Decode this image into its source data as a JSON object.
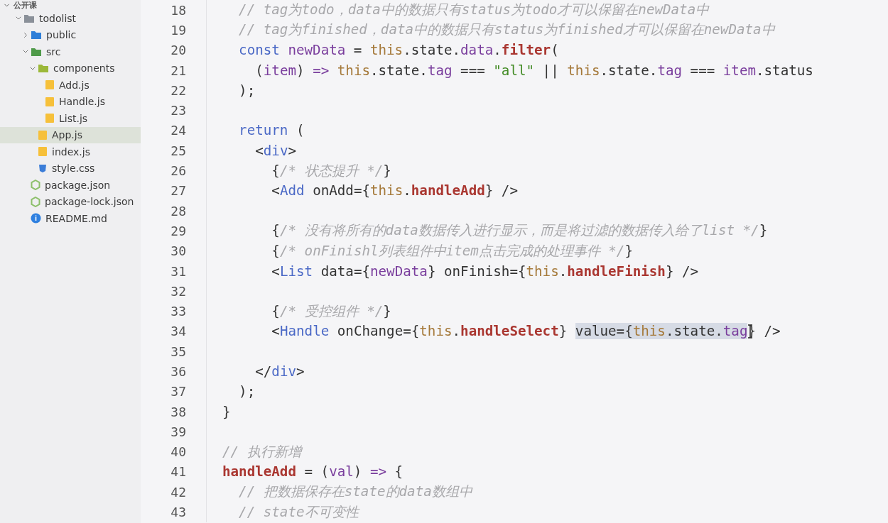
{
  "explorer": {
    "root": {
      "name": "公开课",
      "expanded": true
    },
    "items": [
      {
        "name": "todolist",
        "kind": "folder",
        "color": "#8a9099",
        "expanded": true,
        "selected": false,
        "children": [
          {
            "name": "public",
            "kind": "folder",
            "color": "#2f7fd8",
            "expanded": false,
            "selected": false
          },
          {
            "name": "src",
            "kind": "folder",
            "color": "#4f9a4a",
            "expanded": true,
            "selected": false,
            "children": [
              {
                "name": "components",
                "kind": "folder",
                "color": "#9cb83a",
                "expanded": true,
                "selected": false,
                "children": [
                  {
                    "name": "Add.js",
                    "kind": "js",
                    "selected": false
                  },
                  {
                    "name": "Handle.js",
                    "kind": "js",
                    "selected": false
                  },
                  {
                    "name": "List.js",
                    "kind": "js",
                    "selected": false
                  }
                ]
              },
              {
                "name": "App.js",
                "kind": "js",
                "selected": true
              },
              {
                "name": "index.js",
                "kind": "js",
                "selected": false
              },
              {
                "name": "style.css",
                "kind": "css",
                "selected": false
              }
            ]
          },
          {
            "name": "package.json",
            "kind": "json",
            "selected": false
          },
          {
            "name": "package-lock.json",
            "kind": "json",
            "selected": false
          },
          {
            "name": "README.md",
            "kind": "info",
            "selected": false
          }
        ]
      }
    ]
  },
  "editor": {
    "lines": [
      {
        "number": "18",
        "kind": "inner",
        "segments": [
          {
            "selected": false,
            "tokens": [
              {
                "text": "// tag为todo，data中的数据只有status为todo才可以保留在newData中",
                "kind": "comment"
              }
            ]
          }
        ]
      },
      {
        "number": "19",
        "kind": "inner",
        "segments": [
          {
            "selected": false,
            "tokens": [
              {
                "text": "// tag为finished，data中的数据只有status为finished才可以保留在newData中",
                "kind": "comment"
              }
            ]
          }
        ]
      },
      {
        "number": "20",
        "kind": "inner",
        "segments": [
          {
            "selected": false,
            "tokens": [
              {
                "text": "const ",
                "kind": "keyword"
              },
              {
                "text": "newData",
                "kind": "var"
              },
              {
                "text": " = ",
                "kind": "plain"
              },
              {
                "text": "this",
                "kind": "this"
              },
              {
                "text": ".state.",
                "kind": "plain"
              },
              {
                "text": "data",
                "kind": "prop"
              },
              {
                "text": ".",
                "kind": "plain"
              },
              {
                "text": "filter",
                "kind": "method"
              },
              {
                "text": "(",
                "kind": "plain"
              }
            ]
          }
        ]
      },
      {
        "number": "21",
        "kind": "deeper",
        "segments": [
          {
            "selected": false,
            "tokens": [
              {
                "text": "(",
                "kind": "plain"
              },
              {
                "text": "item",
                "kind": "var"
              },
              {
                "text": ") ",
                "kind": "plain"
              },
              {
                "text": "=> ",
                "kind": "op"
              },
              {
                "text": "this",
                "kind": "this"
              },
              {
                "text": ".state.",
                "kind": "plain"
              },
              {
                "text": "tag",
                "kind": "prop"
              },
              {
                "text": " === ",
                "kind": "plain"
              },
              {
                "text": "\"all\"",
                "kind": "string"
              },
              {
                "text": " || ",
                "kind": "plain"
              },
              {
                "text": "this",
                "kind": "this"
              },
              {
                "text": ".state.",
                "kind": "plain"
              },
              {
                "text": "tag",
                "kind": "prop"
              },
              {
                "text": " === ",
                "kind": "plain"
              },
              {
                "text": "item",
                "kind": "var"
              },
              {
                "text": ".status",
                "kind": "plain"
              }
            ]
          }
        ]
      },
      {
        "number": "22",
        "kind": "inner",
        "segments": [
          {
            "selected": false,
            "tokens": [
              {
                "text": ");",
                "kind": "plain"
              }
            ]
          }
        ]
      },
      {
        "number": "23"
      },
      {
        "number": "24",
        "kind": "inner",
        "segments": [
          {
            "selected": false,
            "tokens": [
              {
                "text": "return",
                "kind": "keyword"
              },
              {
                "text": " (",
                "kind": "plain"
              }
            ]
          }
        ]
      },
      {
        "number": "25",
        "kind": "deeper",
        "segments": [
          {
            "selected": false,
            "tokens": [
              {
                "text": "<",
                "kind": "plain"
              },
              {
                "text": "div",
                "kind": "tag"
              },
              {
                "text": ">",
                "kind": "plain"
              }
            ]
          }
        ]
      },
      {
        "number": "26",
        "kind": "deepest",
        "segments": [
          {
            "selected": false,
            "tokens": [
              {
                "text": "{",
                "kind": "plain"
              },
              {
                "text": "/* 状态提升 */",
                "kind": "comment"
              },
              {
                "text": "}",
                "kind": "plain"
              }
            ]
          }
        ]
      },
      {
        "number": "27",
        "kind": "deepest",
        "segments": [
          {
            "selected": false,
            "tokens": [
              {
                "text": "<",
                "kind": "plain"
              },
              {
                "text": "Add",
                "kind": "tag"
              },
              {
                "text": " onAdd={",
                "kind": "plain"
              },
              {
                "text": "this",
                "kind": "this"
              },
              {
                "text": ".",
                "kind": "plain"
              },
              {
                "text": "handleAdd",
                "kind": "method"
              },
              {
                "text": "} />",
                "kind": "plain"
              }
            ]
          }
        ]
      },
      {
        "number": "28"
      },
      {
        "number": "29",
        "kind": "deepest",
        "segments": [
          {
            "selected": false,
            "tokens": [
              {
                "text": "{",
                "kind": "plain"
              },
              {
                "text": "/* 没有将所有的data数据传入进行显示，而是将过滤的数据传入给了list */",
                "kind": "comment"
              },
              {
                "text": "}",
                "kind": "plain"
              }
            ]
          }
        ]
      },
      {
        "number": "30",
        "kind": "deepest",
        "segments": [
          {
            "selected": false,
            "tokens": [
              {
                "text": "{",
                "kind": "plain"
              },
              {
                "text": "/* onFinishl列表组件中item点击完成的处理事件 */",
                "kind": "comment"
              },
              {
                "text": "}",
                "kind": "plain"
              }
            ]
          }
        ]
      },
      {
        "number": "31",
        "kind": "deepest",
        "segments": [
          {
            "selected": false,
            "tokens": [
              {
                "text": "<",
                "kind": "plain"
              },
              {
                "text": "List",
                "kind": "tag"
              },
              {
                "text": " data={",
                "kind": "plain"
              },
              {
                "text": "newData",
                "kind": "var"
              },
              {
                "text": "} onFinish={",
                "kind": "plain"
              },
              {
                "text": "this",
                "kind": "this"
              },
              {
                "text": ".",
                "kind": "plain"
              },
              {
                "text": "handleFinish",
                "kind": "method"
              },
              {
                "text": "} />",
                "kind": "plain"
              }
            ]
          }
        ]
      },
      {
        "number": "32"
      },
      {
        "number": "33",
        "kind": "deepest",
        "segments": [
          {
            "selected": false,
            "tokens": [
              {
                "text": "{",
                "kind": "plain"
              },
              {
                "text": "/* 受控组件 */",
                "kind": "comment"
              },
              {
                "text": "}",
                "kind": "plain"
              }
            ]
          }
        ]
      },
      {
        "number": "34",
        "kind": "deepest",
        "segments": [
          {
            "selected": false,
            "tokens": [
              {
                "text": "<",
                "kind": "plain"
              },
              {
                "text": "Handle",
                "kind": "tag"
              },
              {
                "text": " onChange={",
                "kind": "plain"
              },
              {
                "text": "this",
                "kind": "this"
              },
              {
                "text": ".",
                "kind": "plain"
              },
              {
                "text": "handleSelect",
                "kind": "method"
              },
              {
                "text": "} ",
                "kind": "plain"
              }
            ]
          },
          {
            "selected": true,
            "tokens": [
              {
                "text": "value={",
                "kind": "plain"
              },
              {
                "text": "this",
                "kind": "this"
              },
              {
                "text": ".state.",
                "kind": "plain"
              },
              {
                "text": "tag",
                "kind": "prop"
              }
            ]
          },
          {
            "selected": false,
            "tokens": [
              {
                "text": "} />",
                "kind": "plain"
              }
            ]
          }
        ]
      },
      {
        "number": "35"
      },
      {
        "number": "36",
        "kind": "deeper",
        "segments": [
          {
            "selected": false,
            "tokens": [
              {
                "text": "</",
                "kind": "plain"
              },
              {
                "text": "div",
                "kind": "tag"
              },
              {
                "text": ">",
                "kind": "plain"
              }
            ]
          }
        ]
      },
      {
        "number": "37",
        "kind": "inner",
        "segments": [
          {
            "selected": false,
            "tokens": [
              {
                "text": ");",
                "kind": "plain"
              }
            ]
          }
        ]
      },
      {
        "number": "38",
        "kind": "top",
        "segments": [
          {
            "selected": false,
            "tokens": [
              {
                "text": "}",
                "kind": "plain"
              }
            ]
          }
        ]
      },
      {
        "number": "39"
      },
      {
        "number": "40",
        "kind": "top",
        "segments": [
          {
            "selected": false,
            "tokens": [
              {
                "text": "// 执行新增",
                "kind": "comment"
              }
            ]
          }
        ]
      },
      {
        "number": "41",
        "kind": "top",
        "segments": [
          {
            "selected": false,
            "tokens": [
              {
                "text": "handleAdd",
                "kind": "method"
              },
              {
                "text": " = (",
                "kind": "plain"
              },
              {
                "text": "val",
                "kind": "var"
              },
              {
                "text": ") ",
                "kind": "plain"
              },
              {
                "text": "=> ",
                "kind": "op"
              },
              {
                "text": "{",
                "kind": "plain"
              }
            ]
          }
        ]
      },
      {
        "number": "42",
        "kind": "inner",
        "segments": [
          {
            "selected": false,
            "tokens": [
              {
                "text": "// 把数据保存在state的data数组中",
                "kind": "comment"
              }
            ]
          }
        ]
      },
      {
        "number": "43",
        "kind": "inner",
        "segments": [
          {
            "selected": false,
            "tokens": [
              {
                "text": "// state不可变性",
                "kind": "comment"
              }
            ]
          }
        ]
      }
    ]
  }
}
